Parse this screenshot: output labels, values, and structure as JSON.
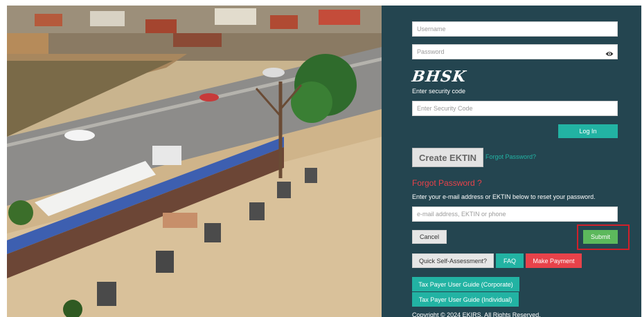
{
  "login": {
    "username_placeholder": "Username",
    "password_placeholder": "Password",
    "captcha_text": "BHSK",
    "security_code_label": "Enter security code",
    "security_code_placeholder": "Enter Security Code",
    "login_button": "Log In",
    "create_button": "Create EKTIN",
    "forgot_link": "Forgot Password?"
  },
  "reset": {
    "heading": "Forgot Password ?",
    "instruction": "Enter your e-mail address or EKTIN below to reset your password.",
    "input_placeholder": "e-mail address, EKTIN or phone",
    "cancel_button": "Cancel",
    "submit_button": "Submit"
  },
  "actions": {
    "self_assessment": "Quick Self-Assessment?",
    "faq": "FAQ",
    "make_payment": "Make Payment",
    "guide_corporate": "Tax Payer User Guide (Corporate)",
    "guide_individual": "Tax Payer User Guide (Individual)"
  },
  "footer": {
    "copyright": "Copyright © 2024 EKIRS. All Rights Reserved."
  },
  "colors": {
    "panel_bg": "#244550",
    "accent_teal": "#22b3a3",
    "danger_red": "#e8424a",
    "submit_green": "#5cb85c",
    "highlight_red": "#d0202a"
  },
  "icons": {
    "password_toggle": "eye-icon"
  }
}
